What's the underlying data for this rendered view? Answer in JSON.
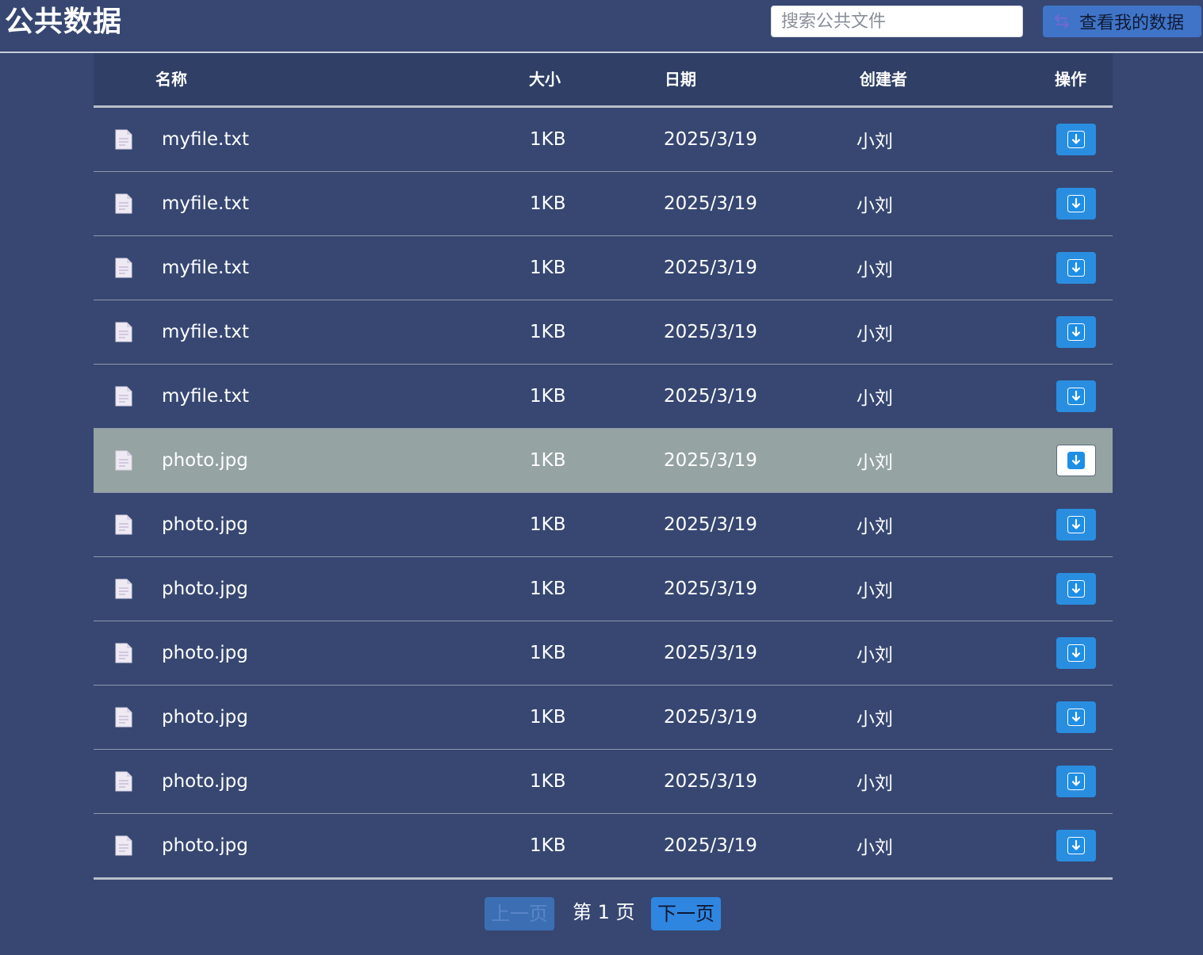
{
  "header": {
    "title": "公共数据",
    "search_placeholder": "搜索公共文件",
    "my_data_label": "查看我的数据"
  },
  "table": {
    "columns": [
      "名称",
      "大小",
      "日期",
      "创建者",
      "操作"
    ],
    "rows": [
      {
        "name": "myfile.txt",
        "size": "1KB",
        "date": "2025/3/19",
        "creator": "小刘"
      },
      {
        "name": "myfile.txt",
        "size": "1KB",
        "date": "2025/3/19",
        "creator": "小刘"
      },
      {
        "name": "myfile.txt",
        "size": "1KB",
        "date": "2025/3/19",
        "creator": "小刘"
      },
      {
        "name": "myfile.txt",
        "size": "1KB",
        "date": "2025/3/19",
        "creator": "小刘"
      },
      {
        "name": "myfile.txt",
        "size": "1KB",
        "date": "2025/3/19",
        "creator": "小刘"
      },
      {
        "name": "photo.jpg",
        "size": "1KB",
        "date": "2025/3/19",
        "creator": "小刘"
      },
      {
        "name": "photo.jpg",
        "size": "1KB",
        "date": "2025/3/19",
        "creator": "小刘"
      },
      {
        "name": "photo.jpg",
        "size": "1KB",
        "date": "2025/3/19",
        "creator": "小刘"
      },
      {
        "name": "photo.jpg",
        "size": "1KB",
        "date": "2025/3/19",
        "creator": "小刘"
      },
      {
        "name": "photo.jpg",
        "size": "1KB",
        "date": "2025/3/19",
        "creator": "小刘"
      },
      {
        "name": "photo.jpg",
        "size": "1KB",
        "date": "2025/3/19",
        "creator": "小刘"
      },
      {
        "name": "photo.jpg",
        "size": "1KB",
        "date": "2025/3/19",
        "creator": "小刘"
      }
    ],
    "hovered_row": 5,
    "row_icon": "file-icon",
    "action_icon": "download-icon"
  },
  "pagination": {
    "prev_label": "上一页",
    "page_label": "第 1 页",
    "next_label": "下一页"
  },
  "colors": {
    "background": "#374772",
    "header_row": "#2f3f66",
    "hover_row": "#95a3a2",
    "accent": "#2a8ee0"
  }
}
